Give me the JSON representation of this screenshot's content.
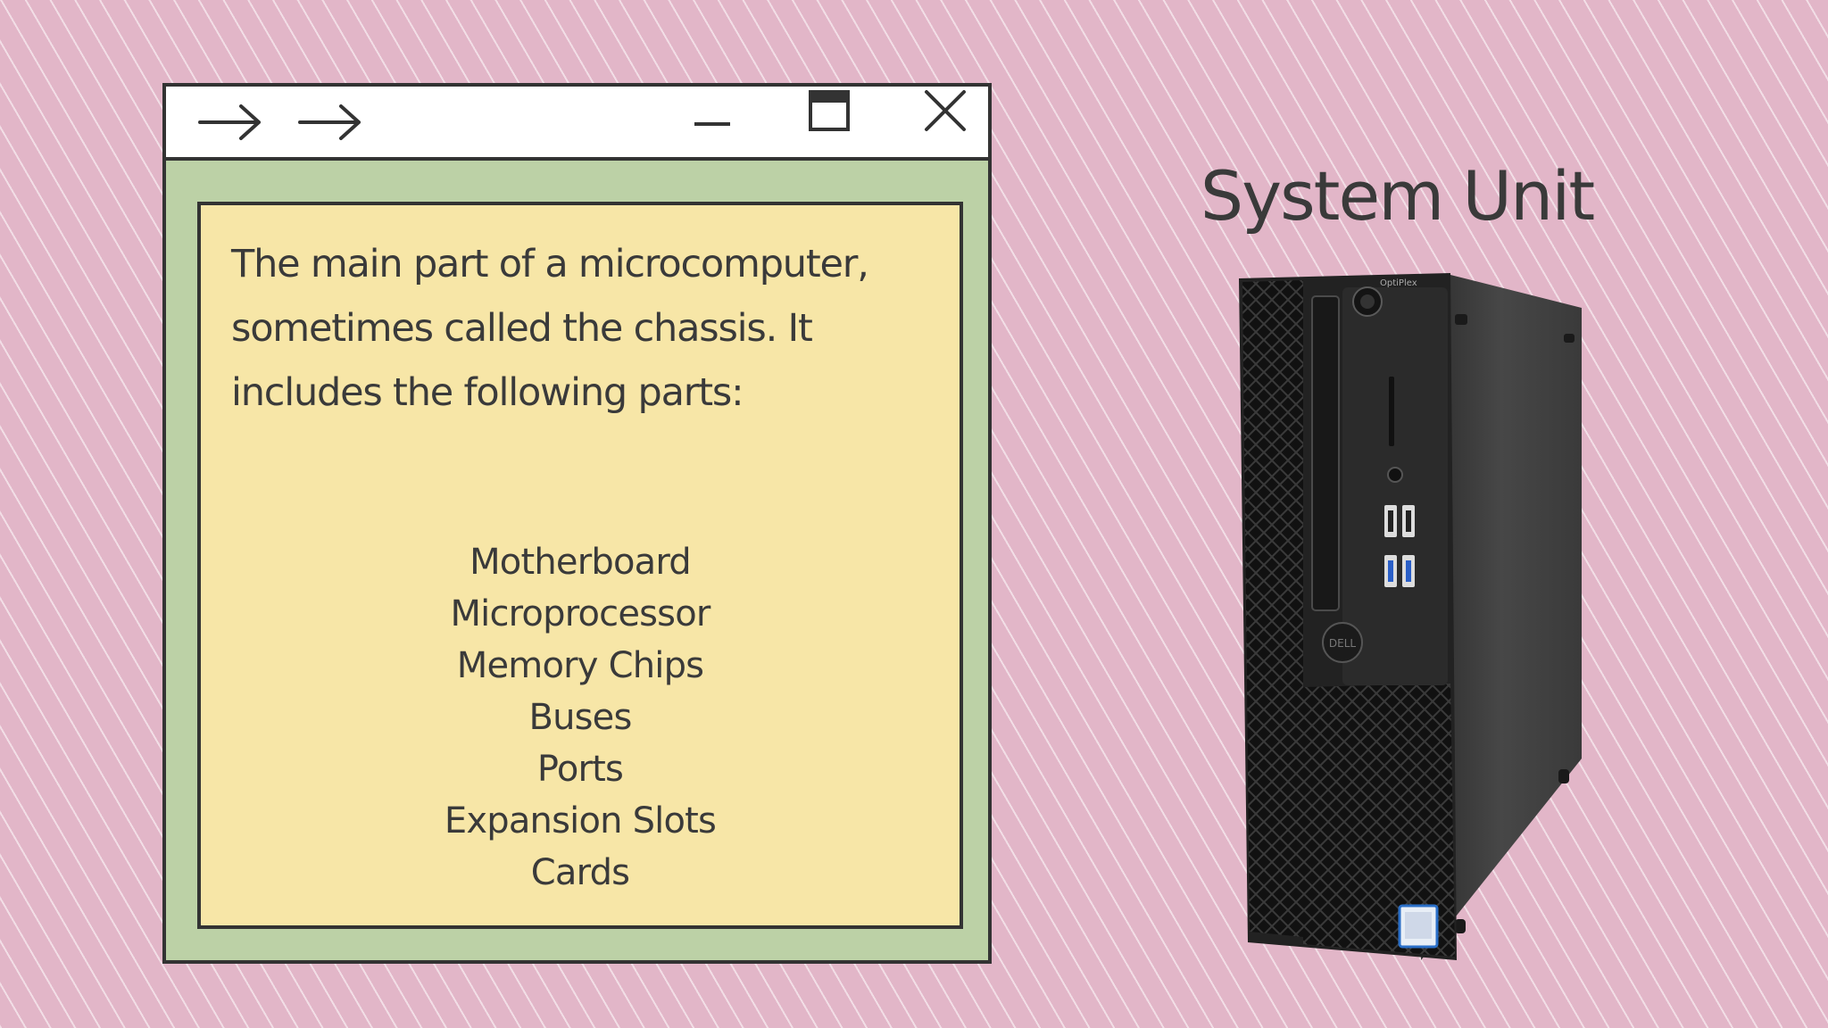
{
  "slide": {
    "title": "System Unit"
  },
  "window": {
    "controls": {
      "back_icon": "arrow-right-icon",
      "forward_icon": "arrow-right-icon",
      "minimize_icon": "minimize-icon",
      "maximize_icon": "maximize-icon",
      "close_icon": "close-icon"
    },
    "intro_text": "The main part of a microcomputer, sometimes called the chassis. It includes the following parts:",
    "parts": [
      "Motherboard",
      "Microprocessor",
      "Memory Chips",
      "Buses",
      "Ports",
      "Expansion Slots",
      "Cards"
    ]
  },
  "colors": {
    "background": "#e2b6c8",
    "window_frame": "#bcd1a6",
    "content_panel": "#f7e6a7",
    "border": "#333333",
    "text": "#3a3a3a"
  }
}
